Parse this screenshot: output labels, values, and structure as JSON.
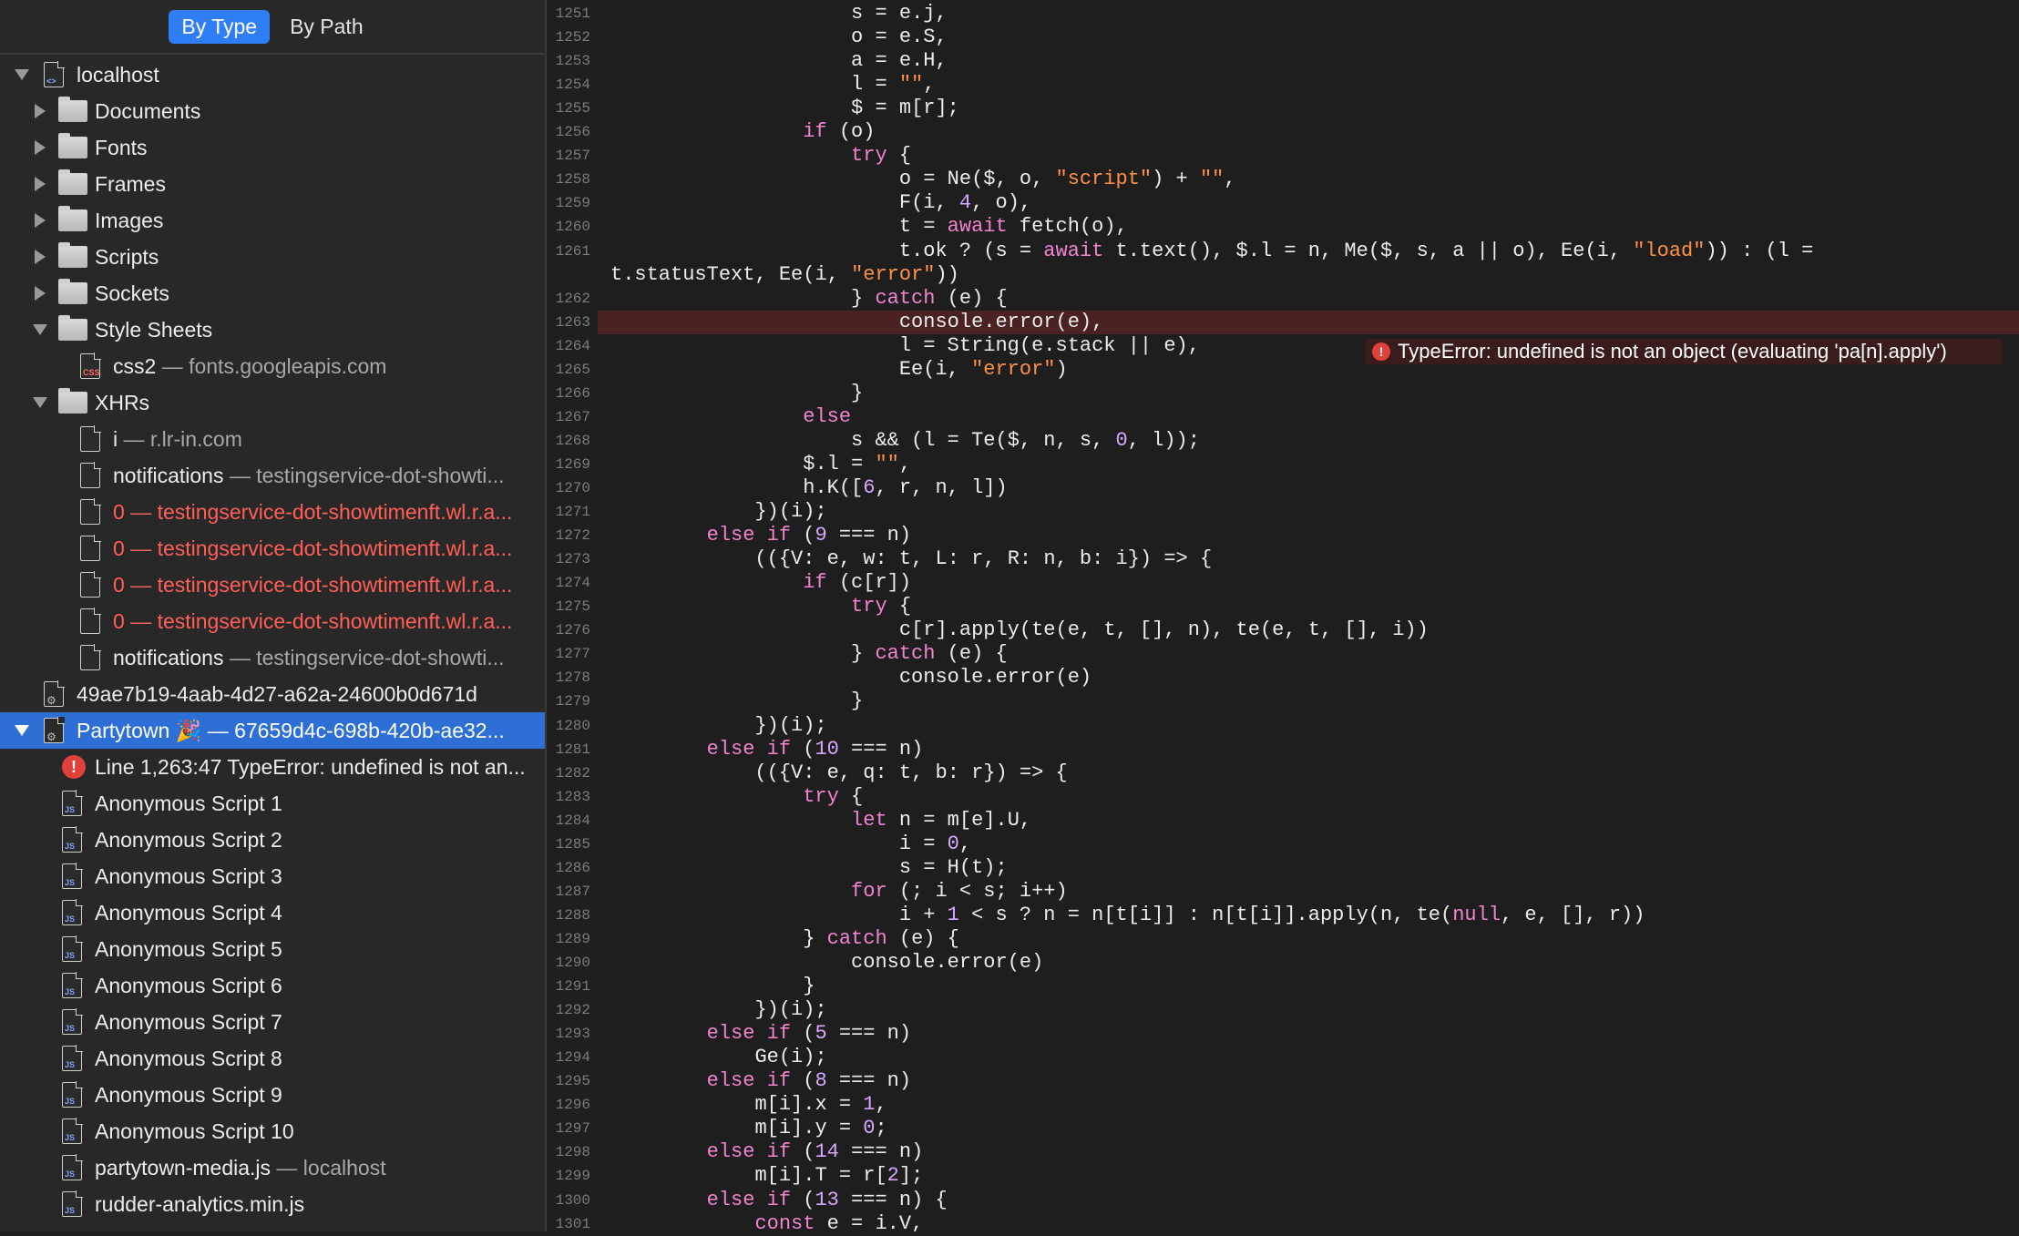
{
  "scope_bar": {
    "by_type": "By Type",
    "by_path": "By Path"
  },
  "tree": {
    "localhost": "localhost",
    "folders": {
      "documents": "Documents",
      "fonts": "Fonts",
      "frames": "Frames",
      "images": "Images",
      "scripts": "Scripts",
      "sockets": "Sockets",
      "style_sheets": "Style Sheets",
      "xhrs": "XHRs"
    },
    "css2": {
      "name": "css2",
      "sub": " — fonts.googleapis.com"
    },
    "xhr_items": [
      {
        "name": "i",
        "sub": " — r.lr-in.com"
      },
      {
        "name": "notifications",
        "sub": " — testingservice-dot-showti..."
      },
      {
        "name": "0 — testingservice-dot-showtimenft.wl.r.a..."
      },
      {
        "name": "0 — testingservice-dot-showtimenft.wl.r.a..."
      },
      {
        "name": "0 — testingservice-dot-showtimenft.wl.r.a..."
      },
      {
        "name": "0 — testingservice-dot-showtimenft.wl.r.a..."
      },
      {
        "name": "notifications",
        "sub": " — testingservice-dot-showti..."
      }
    ],
    "worker1": "49ae7b19-4aab-4d27-a62a-24600b0d671d",
    "partytown": "Partytown 🎉 — 67659d4c-698b-420b-ae32...",
    "error_item": "Line 1,263:47 TypeError: undefined is not an...",
    "scripts": [
      "Anonymous Script 1",
      "Anonymous Script 2",
      "Anonymous Script 3",
      "Anonymous Script 4",
      "Anonymous Script 5",
      "Anonymous Script 6",
      "Anonymous Script 7",
      "Anonymous Script 8",
      "Anonymous Script 9",
      "Anonymous Script 10"
    ],
    "partytown_media": {
      "name": "partytown-media.js",
      "sub": " — localhost"
    },
    "rudder": "rudder-analytics.min.js"
  },
  "editor": {
    "line_numbers": [
      "1251",
      "1252",
      "1253",
      "1254",
      "1255",
      "1256",
      "1257",
      "1258",
      "1259",
      "1260",
      "1261",
      "",
      "1262",
      "1263",
      "1264",
      "1265",
      "1266",
      "1267",
      "1268",
      "1269",
      "1270",
      "1271",
      "1272",
      "1273",
      "1274",
      "1275",
      "1276",
      "1277",
      "1278",
      "1279",
      "1280",
      "1281",
      "1282",
      "1283",
      "1284",
      "1285",
      "1286",
      "1287",
      "1288",
      "1289",
      "1290",
      "1291",
      "1292",
      "1293",
      "1294",
      "1295",
      "1296",
      "1297",
      "1298",
      "1299",
      "1300",
      "1301"
    ],
    "highlighted_line": "1263",
    "error_message": "TypeError: undefined is not an object (evaluating 'pa[n].apply')",
    "lines": [
      "                    s = e.j,",
      "                    o = e.S,",
      "                    a = e.H,",
      "                    l = \"\",",
      "                    $ = m[r];",
      "                if (o)",
      "                    try {",
      "                        o = Ne($, o, \"script\") + \"\",",
      "                        F(i, 4, o),",
      "                        t = await fetch(o),",
      "                        t.ok ? (s = await t.text(), $.l = n, Me($, s, a || o), Ee(i, \"load\")) : (l =",
      "t.statusText, Ee(i, \"error\"))",
      "                    } catch (e) {",
      "                        console.error(e),",
      "                        l = String(e.stack || e),",
      "                        Ee(i, \"error\")",
      "                    }",
      "                else",
      "                    s && (l = Te($, n, s, 0, l));",
      "                $.l = \"\",",
      "                h.K([6, r, n, l])",
      "            })(i);",
      "        else if (9 === n)",
      "            (({V: e, w: t, L: r, R: n, b: i}) => {",
      "                if (c[r])",
      "                    try {",
      "                        c[r].apply(te(e, t, [], n), te(e, t, [], i))",
      "                    } catch (e) {",
      "                        console.error(e)",
      "                    }",
      "            })(i);",
      "        else if (10 === n)",
      "            (({V: e, q: t, b: r}) => {",
      "                try {",
      "                    let n = m[e].U,",
      "                        i = 0,",
      "                        s = H(t);",
      "                    for (; i < s; i++)",
      "                        i + 1 < s ? n = n[t[i]] : n[t[i]].apply(n, te(null, e, [], r))",
      "                } catch (e) {",
      "                    console.error(e)",
      "                }",
      "            })(i);",
      "        else if (5 === n)",
      "            Ge(i);",
      "        else if (8 === n)",
      "            m[i].x = 1,",
      "            m[i].y = 0;",
      "        else if (14 === n)",
      "            m[i].T = r[2];",
      "        else if (13 === n) {",
      "            const e = i.V,"
    ]
  },
  "colors": {
    "accent": "#2f7ef6",
    "selection": "#2e6fd6",
    "keyword": "#f283cf",
    "string": "#ff9147",
    "number": "#d6a8ff",
    "error": "#e0413a"
  },
  "icons": [
    "disclosure-triangle-icon",
    "folder-icon",
    "document-icon",
    "html-document-icon",
    "css-document-icon",
    "js-document-icon",
    "worker-icon",
    "error-icon"
  ]
}
